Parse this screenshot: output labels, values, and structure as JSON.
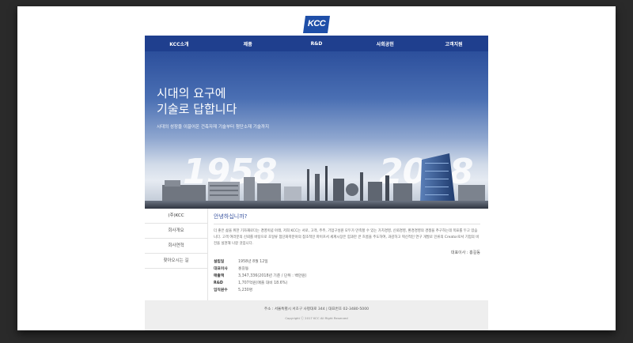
{
  "logo": {
    "text": "KCC",
    "color": "#1f4fa8"
  },
  "nav": {
    "items": [
      "KCC소개",
      "제품",
      "R&D",
      "사회공헌",
      "고객지원"
    ],
    "background": "#1f3f8e"
  },
  "hero": {
    "title": "시대의 요구에\n기술로 답합니다",
    "subtitle": "시대의 성장을 이끌어온 건축자재 기술부터 첨단소재 기술까지",
    "year_left": "1958",
    "year_right": "2018"
  },
  "sidebar": {
    "items": [
      {
        "label": "(주)KCC"
      },
      {
        "label": "회사개요"
      },
      {
        "label": "회사연혁"
      },
      {
        "label": "찾아오시는 길"
      }
    ]
  },
  "main": {
    "greeting": "안녕하십니까?",
    "paragraph": "더 좋은 삶을 위한 기자재로다는 경영이념 아래, 저희 KCC는 서로, 고객, 주주, 기업구성원 모두가 만족할 수 있는 가치경영, 신뢰경영, 환경경영의 경쟁을 추구하는데 목표를 두고 있습니다. 고객 여러분의 신뢰를 바탕으로 초일류 첨단화학분야의 참조적인 파이프서 세계시장은 힘과만 큰 흐름을 주도하여, 과감하고 혁신적인 연구 개발로 인류의 Creator로서 기업의 비전을 실현해 나갈 것입니다.",
    "ceo": "대표이사 : 홍길동",
    "info": [
      {
        "label": "설립일",
        "value": "1958년 8월 12일"
      },
      {
        "label": "대표이사",
        "value": "홍길동"
      },
      {
        "label": "매출액",
        "value": "3,347,336(2018년 기준 / 단위 : 백만원)"
      },
      {
        "label": "R&D",
        "value": "1,707억원(매출 대비 18.6%)"
      },
      {
        "label": "임직원수",
        "value": "5,230명"
      }
    ]
  },
  "footer": {
    "address": "주소 : 서울특별시 서초구 사평대로 344 | 대표번호 02-3480-5000",
    "copyright": "Copyright ⓒ 2017 KCC All Right Reserved"
  }
}
